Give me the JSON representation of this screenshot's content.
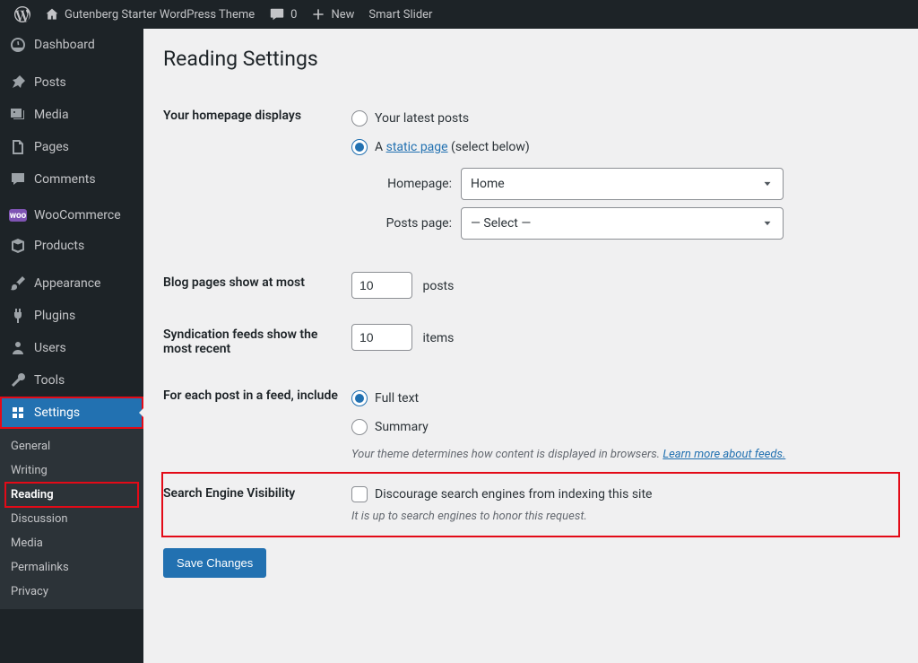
{
  "toolbar": {
    "site_title": "Gutenberg Starter WordPress Theme",
    "comments_count": "0",
    "new_label": "New",
    "smart_slider": "Smart Slider"
  },
  "sidebar": {
    "items": [
      {
        "label": "Dashboard"
      },
      {
        "label": "Posts"
      },
      {
        "label": "Media"
      },
      {
        "label": "Pages"
      },
      {
        "label": "Comments"
      },
      {
        "label": "WooCommerce"
      },
      {
        "label": "Products"
      },
      {
        "label": "Appearance"
      },
      {
        "label": "Plugins"
      },
      {
        "label": "Users"
      },
      {
        "label": "Tools"
      },
      {
        "label": "Settings"
      }
    ],
    "submenu": [
      "General",
      "Writing",
      "Reading",
      "Discussion",
      "Media",
      "Permalinks",
      "Privacy"
    ]
  },
  "page_title": "Reading Settings",
  "homepage": {
    "row_label": "Your homepage displays",
    "opt_latest": "Your latest posts",
    "opt_static_pre": "A ",
    "opt_static_link": "static page",
    "opt_static_post": " (select below)",
    "homepage_label": "Homepage:",
    "homepage_value": "Home",
    "postspage_label": "Posts page:",
    "postspage_value": "— Select —"
  },
  "blog_pages": {
    "row_label": "Blog pages show at most",
    "value": "10",
    "suffix": "posts"
  },
  "syndication": {
    "row_label": "Syndication feeds show the most recent",
    "value": "10",
    "suffix": "items"
  },
  "feed_include": {
    "row_label": "For each post in a feed, include",
    "opt_full": "Full text",
    "opt_summary": "Summary",
    "hint_pre": "Your theme determines how content is displayed in browsers. ",
    "hint_link": "Learn more about feeds."
  },
  "search_visibility": {
    "row_label": "Search Engine Visibility",
    "checkbox_label": "Discourage search engines from indexing this site",
    "hint": "It is up to search engines to honor this request."
  },
  "save_button": "Save Changes",
  "icons": {
    "woo": "woo"
  }
}
